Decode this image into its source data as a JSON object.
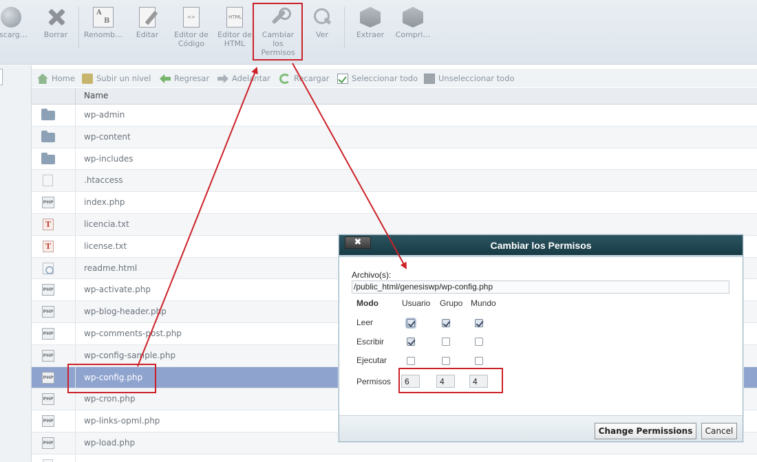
{
  "toolbar": {
    "items": [
      {
        "icon": "download-icon",
        "label": "escarg…"
      },
      {
        "icon": "delete-icon",
        "label": "Borrar"
      },
      {
        "icon": "rename-icon",
        "label": "Renomb…"
      },
      {
        "icon": "edit-icon",
        "label": "Editar"
      },
      {
        "icon": "code-editor-icon",
        "label": "Editor de Código"
      },
      {
        "icon": "html-editor-icon",
        "label": "Editor de HTML"
      },
      {
        "icon": "permissions-icon",
        "label": "Cambiar los Permisos"
      },
      {
        "icon": "view-icon",
        "label": "Ver"
      },
      {
        "icon": "extract-icon",
        "label": "Extraer"
      },
      {
        "icon": "compress-icon",
        "label": "Compri…"
      }
    ],
    "code_glyph": "<>",
    "html_glyph": "HTML",
    "rename_glyph_a": "A",
    "rename_glyph_b": "B"
  },
  "navbar": {
    "home": "Home",
    "up": "Subir un nivel",
    "back": "Regresar",
    "forward": "Adelantar",
    "reload": "Recargar",
    "select_all": "Seleccionar todo",
    "unselect_all": "Unseleccionar todo"
  },
  "table": {
    "column_name": "Name",
    "php_glyph": "PHP",
    "txt_glyph": "T",
    "files": [
      {
        "name": "wp-admin",
        "type": "folder"
      },
      {
        "name": "wp-content",
        "type": "folder"
      },
      {
        "name": "wp-includes",
        "type": "folder"
      },
      {
        "name": ".htaccess",
        "type": "file"
      },
      {
        "name": "index.php",
        "type": "php"
      },
      {
        "name": "licencia.txt",
        "type": "txt"
      },
      {
        "name": "license.txt",
        "type": "txt"
      },
      {
        "name": "readme.html",
        "type": "html"
      },
      {
        "name": "wp-activate.php",
        "type": "php"
      },
      {
        "name": "wp-blog-header.php",
        "type": "php"
      },
      {
        "name": "wp-comments-post.php",
        "type": "php"
      },
      {
        "name": "wp-config-sample.php",
        "type": "php"
      },
      {
        "name": "wp-config.php",
        "type": "php",
        "selected": true
      },
      {
        "name": "wp-cron.php",
        "type": "php"
      },
      {
        "name": "wp-links-opml.php",
        "type": "php"
      },
      {
        "name": "wp-load.php",
        "type": "php"
      },
      {
        "name": "",
        "type": "file"
      }
    ]
  },
  "dialog": {
    "title": "Cambiar los Permisos",
    "close": "✖",
    "files_label": "Archivo(s):",
    "file_path": "/public_html/genesiswp/wp-config.php",
    "mode_header": "Modo",
    "col_user": "Usuario",
    "col_group": "Grupo",
    "col_world": "Mundo",
    "row_read": "Leer",
    "row_write": "Escribir",
    "row_execute": "Ejecutar",
    "row_perms": "Permisos",
    "read": [
      true,
      true,
      true
    ],
    "write": [
      true,
      false,
      false
    ],
    "execute": [
      false,
      false,
      false
    ],
    "perm_user": "6",
    "perm_group": "4",
    "perm_world": "4",
    "change_button": "Change Permissions",
    "cancel_button": "Cancel"
  },
  "annotation_color": "#cc2027"
}
